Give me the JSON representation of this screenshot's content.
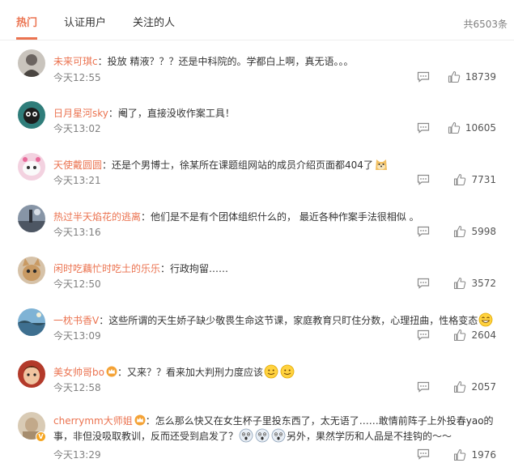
{
  "tabs": {
    "hot": "热门",
    "verified": "认证用户",
    "following": "关注的人"
  },
  "total": "共6503条",
  "colors": {
    "accent": "#eb7350",
    "meta": "#808080"
  },
  "comments": [
    {
      "username": "未来可琪c",
      "colon": "：",
      "text": "投放 精液？？？还是中科院的。学都白上啊，真无语。。。",
      "time": "今天12:55",
      "likes": "18739",
      "avatar": "grey-portrait"
    },
    {
      "username": "日月星河sky",
      "colon": "：",
      "text": "阉了，直接没收作案工具！",
      "time": "今天13:02",
      "likes": "10605",
      "avatar": "cartoon-eyes"
    },
    {
      "username": "天使戴圆圆",
      "colon": "：",
      "text": "还是个男博士，徐某所在课题组网站的成员介绍页面都404了",
      "time": "今天13:21",
      "likes": "7731",
      "avatar": "cute-cat",
      "emoji": "doge-emoji"
    },
    {
      "username": "热过半天焰花的逃离",
      "colon": "：",
      "text": "他们是不是有个团体组织什么的， 最近各种作案手法很相似 。",
      "time": "今天13:16",
      "likes": "5998",
      "avatar": "landscape"
    },
    {
      "username": "闲时吃藕忙时吃土的乐乐",
      "colon": "：",
      "text": "行政拘留……",
      "time": "今天12:50",
      "likes": "3572",
      "avatar": "kitten"
    },
    {
      "username": "一枕书香V",
      "colon": "：",
      "text": "这些所谓的天生娇子缺少敬畏生命这节课，家庭教育只盯住分数，心理扭曲，性格变态",
      "time": "今天13:09",
      "likes": "2604",
      "avatar": "sea-view",
      "emoji": "laugh-emoji"
    },
    {
      "username": "美女帅哥bo",
      "colon": "：",
      "text": "又来？？看来加大判刑力度应该",
      "time": "今天12:58",
      "likes": "2057",
      "avatar": "red-face",
      "badge": "crown-icon",
      "emoji": "grin-emoji"
    },
    {
      "username": "cherrymm大师姐",
      "colon": "：",
      "text1": "怎么那么快又在女生杯子里投东西了，太无语了……敢情前阵子上外投春yao的",
      "text2": "事，非但没吸取教训，反而还受到启发了？",
      "text3": "另外，果然学历和人品是不挂钩的～～",
      "time": "今天13:29",
      "likes": "1976",
      "avatar": "beige-photo",
      "badge": "crown-icon",
      "vbadge": "V"
    }
  ]
}
